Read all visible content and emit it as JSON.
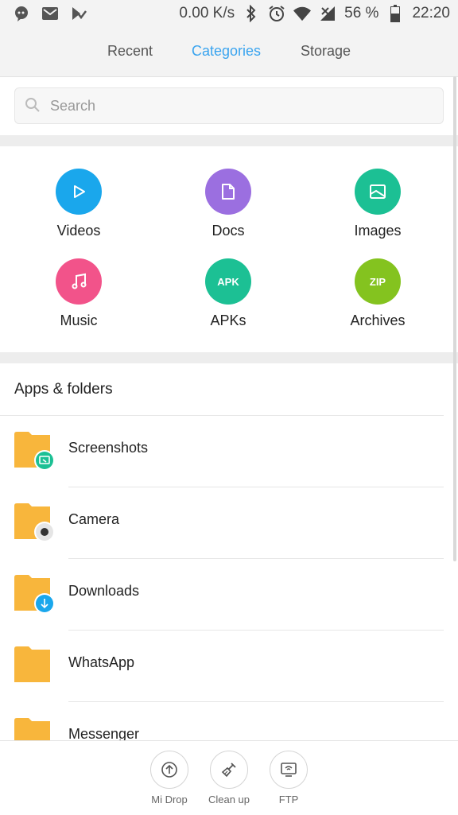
{
  "status_bar": {
    "speed": "0.00 K/s",
    "battery": "56 %",
    "time": "22:20",
    "left_icons": [
      "chat-icon",
      "gmail-icon",
      "download-check-icon"
    ],
    "right_icons": [
      "bluetooth-icon",
      "alarm-icon",
      "wifi-icon",
      "signal-icon",
      "battery-icon"
    ]
  },
  "tabs": [
    {
      "label": "Recent",
      "active": false
    },
    {
      "label": "Categories",
      "active": true
    },
    {
      "label": "Storage",
      "active": false
    }
  ],
  "search": {
    "placeholder": "Search"
  },
  "categories": [
    {
      "label": "Videos",
      "color": "#1aa7ec",
      "icon": "play-icon"
    },
    {
      "label": "Docs",
      "color": "#9b6fe0",
      "icon": "document-icon"
    },
    {
      "label": "Images",
      "color": "#1cc094",
      "icon": "image-icon"
    },
    {
      "label": "Music",
      "color": "#f2538a",
      "icon": "music-icon"
    },
    {
      "label": "APKs",
      "color": "#1cc094",
      "badge": "APK"
    },
    {
      "label": "Archives",
      "color": "#84c31f",
      "badge": "ZIP"
    }
  ],
  "section": {
    "title": "Apps & folders"
  },
  "folders": [
    {
      "name": "Screenshots",
      "badge_icon": "screenshot-icon",
      "badge_color": "#1cc094"
    },
    {
      "name": "Camera",
      "badge_icon": "camera-dot-icon",
      "badge_color": "#e5e5e5"
    },
    {
      "name": "Downloads",
      "badge_icon": "download-arrow-icon",
      "badge_color": "#1aa7ec"
    },
    {
      "name": "WhatsApp",
      "badge_icon": "",
      "badge_color": ""
    },
    {
      "name": "Messenger",
      "badge_icon": "",
      "badge_color": ""
    }
  ],
  "bottom_bar": [
    {
      "label": "Mi Drop",
      "icon": "upload-icon"
    },
    {
      "label": "Clean up",
      "icon": "brush-icon"
    },
    {
      "label": "FTP",
      "icon": "ftp-icon"
    }
  ],
  "colors": {
    "accent": "#3aa4ef",
    "folder": "#f8b63c"
  }
}
